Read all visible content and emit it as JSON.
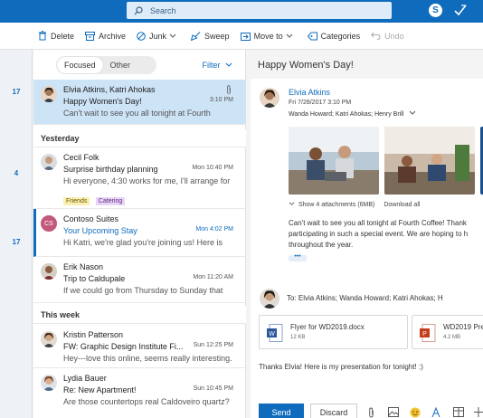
{
  "search": {
    "placeholder": "Search"
  },
  "topbar": {
    "skype_label": "S"
  },
  "toolbar": {
    "delete": "Delete",
    "archive": "Archive",
    "junk": "Junk",
    "sweep": "Sweep",
    "move_to": "Move to",
    "categories": "Categories",
    "undo": "Undo"
  },
  "rail": {
    "dates": [
      "17",
      "4",
      "17"
    ]
  },
  "list": {
    "tabs": {
      "focused": "Focused",
      "other": "Other"
    },
    "filter": "Filter",
    "sections": {
      "yesterday": "Yesterday",
      "this_week": "This week"
    },
    "messages": [
      {
        "from": "Elvia Atkins, Katri Ahokas",
        "subject": "Happy Women's Day!",
        "time": "3:10 PM",
        "preview": "Can't wait to see you all tonight at Fourth"
      },
      {
        "from": "Cecil Folk",
        "subject": "Surprise birthday planning",
        "time": "Mon 10:40 PM",
        "preview": "Hi everyone, 4:30 works for me, I'll arrange for",
        "categories": [
          "Friends",
          "Catering"
        ]
      },
      {
        "from": "Contoso Suites",
        "avatar_initials": "CS",
        "subject": "Your Upcoming Stay",
        "time": "Mon 4:02 PM",
        "preview": "Hi Katri, we're glad you're joining us! Here is"
      },
      {
        "from": "Erik Nason",
        "subject": "Trip to Caldupale",
        "time": "Mon 11:20 AM",
        "preview": "If we could go from Thursday to Sunday that"
      },
      {
        "from": "Kristin Patterson",
        "subject": "FW: Graphic Design Institute Fi...",
        "time": "Sun 12:25 PM",
        "preview": "Hey---love this online, seems really interesting."
      },
      {
        "from": "Lydia Bauer",
        "subject": "Re: New Apartment!",
        "time": "Sun 10:45 PM",
        "preview": "Are those countertops real Caldoveiro quartz?"
      }
    ]
  },
  "reading": {
    "title": "Happy Women's Day!",
    "sender": "Elvia Atkins",
    "date": "Fri 7/28/2017 3:10 PM",
    "recipients": "Wanda Howard; Katri Ahokas; Henry Brill",
    "attachments_show": "Show 4 attachments (6MB)",
    "attachments_download": "Download all",
    "body_lines": [
      "Can't wait to see you all tonight at Fourth Coffee! Thank",
      "participating in such a special event. We are hoping to h",
      "throughout the year."
    ],
    "more": "•••"
  },
  "compose": {
    "to": "To: Elvia Atkins; Wanda Howard; Katri Ahokas; H",
    "files": [
      {
        "name": "Flyer for WD2019.docx",
        "size": "12 KB"
      },
      {
        "name": "WD2019 Pre",
        "size": "4.2 MB"
      }
    ],
    "reply_text": "Thanks Elvia! Here is my presentation for tonight! :)",
    "send_label": "Send",
    "discard_label": "Discard"
  },
  "colors": {
    "accent": "#0f6cbd",
    "selected": "#cde3f6"
  }
}
